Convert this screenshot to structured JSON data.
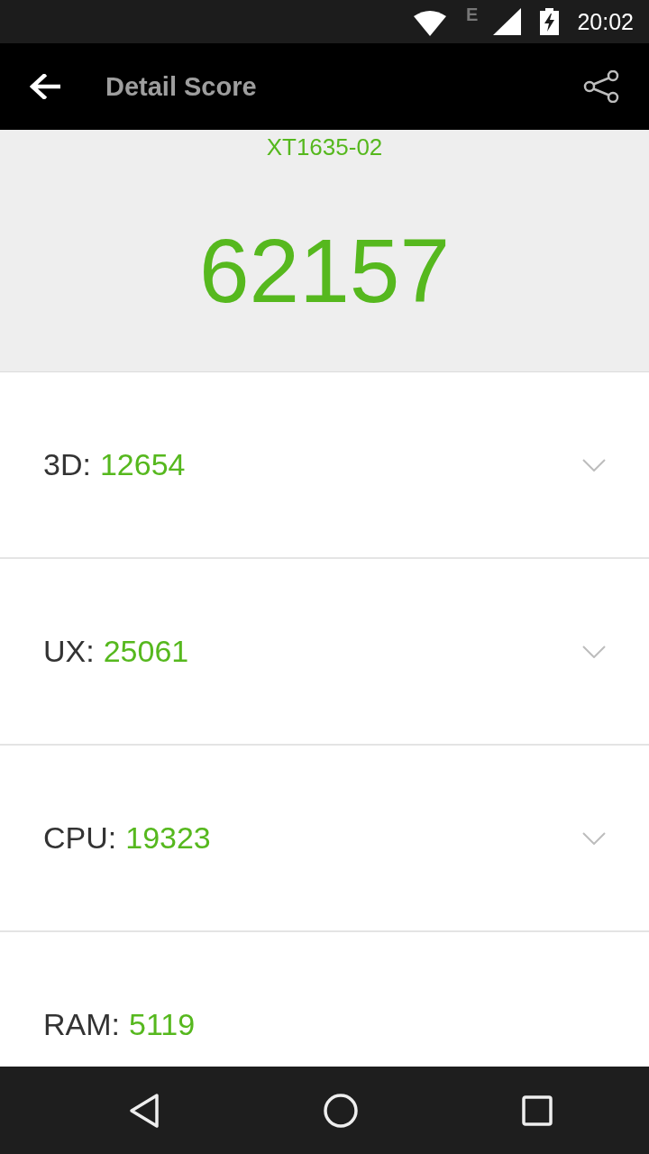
{
  "status_bar": {
    "network_type": "E",
    "time": "20:02"
  },
  "toolbar": {
    "title": "Detail Score"
  },
  "header": {
    "device": "XT1635-02",
    "total_score": "62157"
  },
  "scores": [
    {
      "label": "3D:",
      "value": "12654",
      "expandable": true
    },
    {
      "label": "UX:",
      "value": "25061",
      "expandable": true
    },
    {
      "label": "CPU:",
      "value": "19323",
      "expandable": true
    },
    {
      "label": "RAM:",
      "value": "5119",
      "expandable": false
    }
  ]
}
